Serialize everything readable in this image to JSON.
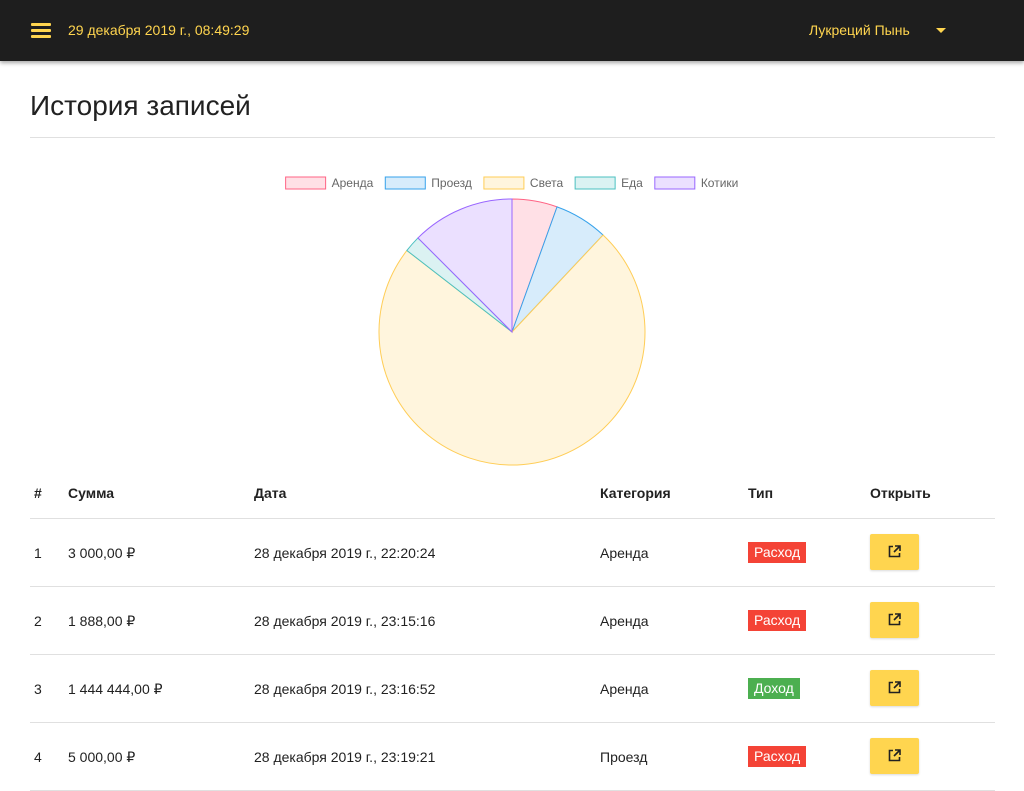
{
  "navbar": {
    "datetime": "29 декабря 2019 г., 08:49:29",
    "user_name": "Лукреций Пынь"
  },
  "page": {
    "title": "История записей"
  },
  "chart_data": {
    "type": "pie",
    "legend_position": "top",
    "categories": [
      "Аренда",
      "Проезд",
      "Света",
      "Еда",
      "Котики"
    ],
    "values": [
      5.5,
      6.5,
      73.5,
      2.0,
      12.5
    ],
    "colors": {
      "fills": [
        "#ffe0e6",
        "#d7ecfb",
        "#fff5dd",
        "#dbf2f2",
        "#ebe0ff"
      ],
      "borders": [
        "#ff6384",
        "#36a2eb",
        "#ffcd56",
        "#4bc0c0",
        "#9966ff"
      ]
    }
  },
  "table": {
    "headers": {
      "num": "#",
      "amount": "Сумма",
      "date": "Дата",
      "category": "Категория",
      "type": "Тип",
      "open": "Открыть"
    },
    "rows": [
      {
        "num": "1",
        "amount": "3 000,00 ₽",
        "date": "28 декабря 2019 г., 22:20:24",
        "category": "Аренда",
        "type": "Расход",
        "type_color": "red"
      },
      {
        "num": "2",
        "amount": "1 888,00 ₽",
        "date": "28 декабря 2019 г., 23:15:16",
        "category": "Аренда",
        "type": "Расход",
        "type_color": "red"
      },
      {
        "num": "3",
        "amount": "1 444 444,00 ₽",
        "date": "28 декабря 2019 г., 23:16:52",
        "category": "Аренда",
        "type": "Доход",
        "type_color": "green"
      },
      {
        "num": "4",
        "amount": "5 000,00 ₽",
        "date": "28 декабря 2019 г., 23:19:21",
        "category": "Проезд",
        "type": "Расход",
        "type_color": "red"
      }
    ]
  },
  "icons": {
    "menu": "hamburger-menu-icon",
    "user_dropdown": "caret-down-icon",
    "open": "open-in-new-icon"
  },
  "colors": {
    "navbar_bg": "#1e1e1e",
    "accent": "#ffd54f",
    "expense": "#f44336",
    "income": "#4caf50"
  }
}
